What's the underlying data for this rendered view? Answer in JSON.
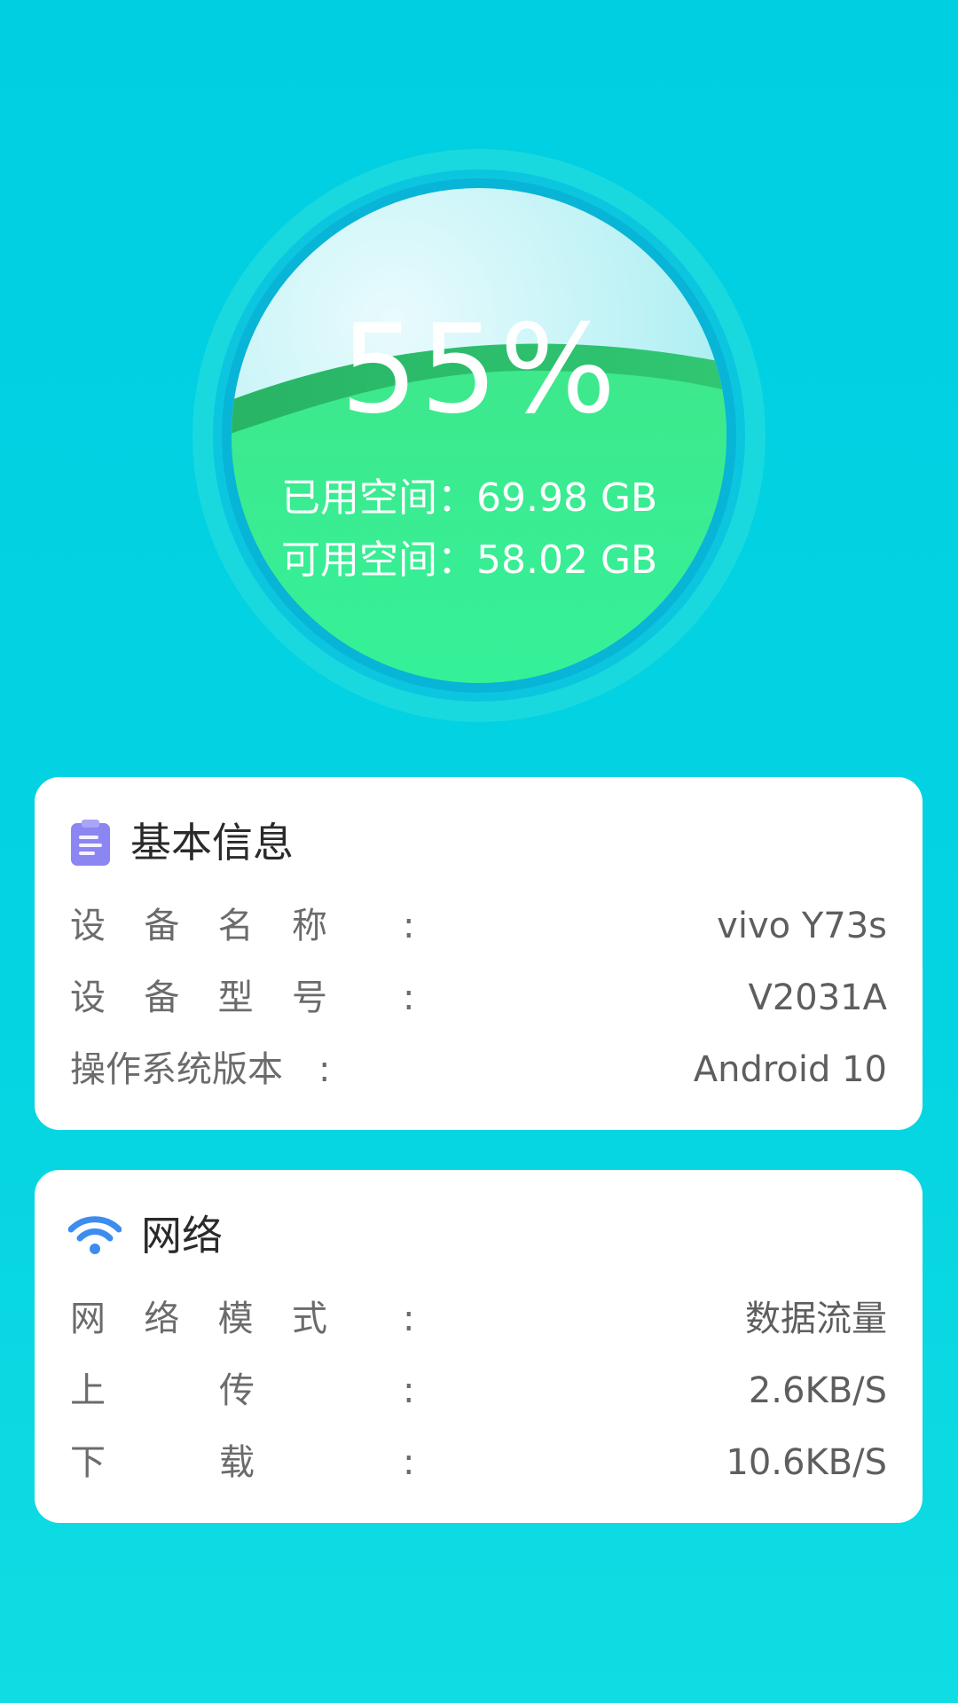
{
  "storage": {
    "percent_text": "55%",
    "used_percent": 55,
    "used_label": "已用空间：",
    "used_value": "69.98 GB",
    "free_label": "可用空间：",
    "free_value": "58.02 GB"
  },
  "basic_info": {
    "icon": "clipboard-icon",
    "title": "基本信息",
    "rows": [
      {
        "label_chars": [
          "设",
          "备",
          "名",
          "称"
        ],
        "colon": ":",
        "value": "vivo Y73s"
      },
      {
        "label_chars": [
          "设",
          "备",
          "型",
          "号"
        ],
        "colon": ":",
        "value": "V2031A"
      },
      {
        "label": "操作系统版本",
        "colon": ":",
        "value": "Android 10"
      }
    ]
  },
  "network": {
    "icon": "wifi-icon",
    "title": "网络",
    "rows": [
      {
        "label_chars": [
          "网",
          "络",
          "模",
          "式"
        ],
        "colon": ":",
        "value": "数据流量"
      },
      {
        "label_chars": [
          "上",
          "传"
        ],
        "colon": ":",
        "value": "2.6KB/S"
      },
      {
        "label_chars": [
          "下",
          "载"
        ],
        "colon": ":",
        "value": "10.6KB/S"
      }
    ]
  },
  "colors": {
    "background": "#00cfe2",
    "gauge_ring": "#08b7d8",
    "gauge_fill": "#38f08f",
    "basic_icon": "#8b86f2",
    "wifi_icon": "#3d8cf0"
  }
}
